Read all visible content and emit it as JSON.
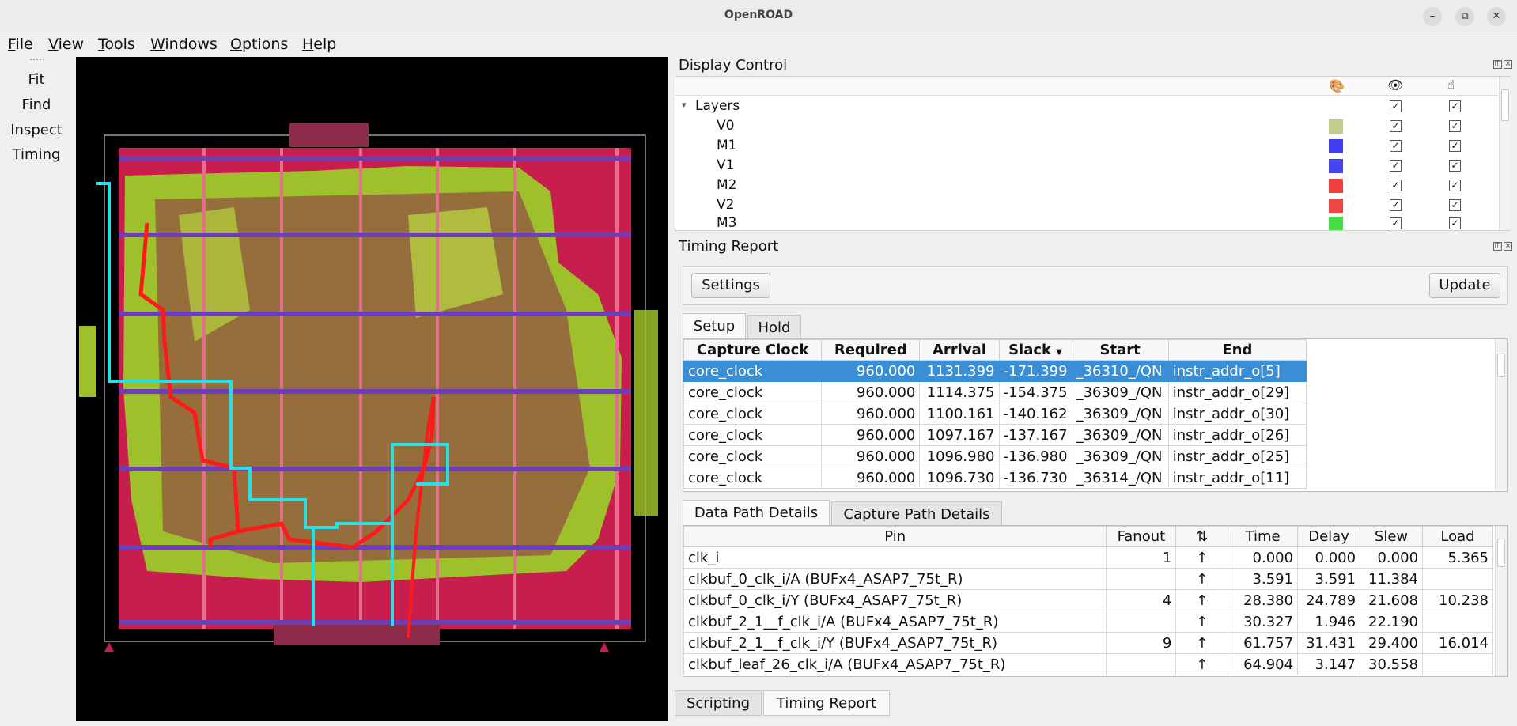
{
  "app": {
    "title": "OpenROAD"
  },
  "window_controls": {
    "minimize": "–",
    "restore": "⧉",
    "close": "✕"
  },
  "menubar": [
    {
      "underline": "F",
      "rest": "ile"
    },
    {
      "underline": "V",
      "rest": "iew"
    },
    {
      "underline": "T",
      "rest": "ools"
    },
    {
      "underline": "W",
      "rest": "indows"
    },
    {
      "underline": "O",
      "rest": "ptions"
    },
    {
      "underline": "H",
      "rest": "elp"
    }
  ],
  "left_toolbar": {
    "fit": "Fit",
    "find": "Find",
    "inspect": "Inspect",
    "timing": "Timing"
  },
  "display_control": {
    "title": "Display Control",
    "root": "Layers",
    "layers": [
      {
        "name": "V0",
        "color": "#c5cc8e"
      },
      {
        "name": "M1",
        "color": "#3f3ff0"
      },
      {
        "name": "V1",
        "color": "#4444f0"
      },
      {
        "name": "M2",
        "color": "#f04040"
      },
      {
        "name": "V2",
        "color": "#f04545"
      },
      {
        "name": "M3",
        "color": "#44dd44"
      }
    ],
    "check_glyph": "✓"
  },
  "timing_report": {
    "title": "Timing Report",
    "settings_label": "Settings",
    "update_label": "Update",
    "tabs": [
      "Setup",
      "Hold"
    ],
    "path_columns": [
      "Capture Clock",
      "Required",
      "Arrival",
      "Slack",
      "Start",
      "End"
    ],
    "paths": [
      [
        "core_clock",
        "960.000",
        "1131.399",
        "-171.399",
        "_36310_/QN",
        "instr_addr_o[5]"
      ],
      [
        "core_clock",
        "960.000",
        "1114.375",
        "-154.375",
        "_36309_/QN",
        "instr_addr_o[29]"
      ],
      [
        "core_clock",
        "960.000",
        "1100.161",
        "-140.162",
        "_36309_/QN",
        "instr_addr_o[30]"
      ],
      [
        "core_clock",
        "960.000",
        "1097.167",
        "-137.167",
        "_36309_/QN",
        "instr_addr_o[26]"
      ],
      [
        "core_clock",
        "960.000",
        "1096.980",
        "-136.980",
        "_36309_/QN",
        "instr_addr_o[25]"
      ],
      [
        "core_clock",
        "960.000",
        "1096.730",
        "-136.730",
        "_36314_/QN",
        "instr_addr_o[11]"
      ]
    ],
    "detail_tabs": [
      "Data Path Details",
      "Capture Path Details"
    ],
    "detail_columns": [
      "Pin",
      "Fanout",
      "⇅",
      "Time",
      "Delay",
      "Slew",
      "Load"
    ],
    "details": [
      [
        "clk_i",
        "1",
        "↑",
        "0.000",
        "0.000",
        "0.000",
        "5.365"
      ],
      [
        "clkbuf_0_clk_i/A (BUFx4_ASAP7_75t_R)",
        "",
        "↑",
        "3.591",
        "3.591",
        "11.384",
        ""
      ],
      [
        "clkbuf_0_clk_i/Y (BUFx4_ASAP7_75t_R)",
        "4",
        "↑",
        "28.380",
        "24.789",
        "21.608",
        "10.238"
      ],
      [
        "clkbuf_2_1__f_clk_i/A (BUFx4_ASAP7_75t_R)",
        "",
        "↑",
        "30.327",
        "1.946",
        "22.190",
        ""
      ],
      [
        "clkbuf_2_1__f_clk_i/Y (BUFx4_ASAP7_75t_R)",
        "9",
        "↑",
        "61.757",
        "31.431",
        "29.400",
        "16.014"
      ],
      [
        "clkbuf_leaf_26_clk_i/A (BUFx4_ASAP7_75t_R)",
        "",
        "↑",
        "64.904",
        "3.147",
        "30.558",
        ""
      ]
    ]
  },
  "bottom_tabs": [
    "Scripting",
    "Timing Report"
  ]
}
